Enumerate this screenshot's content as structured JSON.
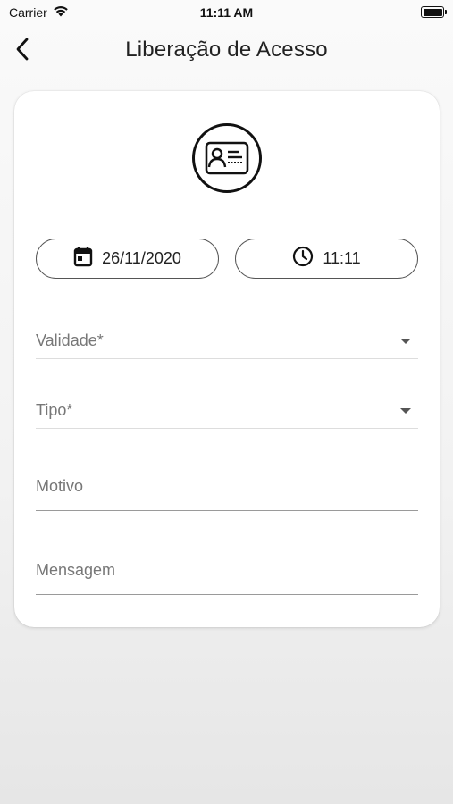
{
  "status_bar": {
    "carrier": "Carrier",
    "time": "11:11 AM",
    "wifi_icon": "wifi-icon",
    "battery_icon": "battery-icon"
  },
  "nav": {
    "back_icon": "chevron-left-icon",
    "title": "Liberação de Acesso"
  },
  "card": {
    "badge_icon": "id-card-icon",
    "date_button": {
      "icon": "calendar-icon",
      "label": "26/11/2020"
    },
    "time_button": {
      "icon": "clock-icon",
      "label": "11:11"
    },
    "fields": {
      "validade": {
        "placeholder": "Validade*",
        "type": "dropdown"
      },
      "tipo": {
        "placeholder": "Tipo*",
        "type": "dropdown"
      },
      "motivo": {
        "placeholder": "Motivo",
        "type": "text"
      },
      "mensagem": {
        "placeholder": "Mensagem",
        "type": "text"
      }
    }
  },
  "colors": {
    "background_top": "#fafafa",
    "background_bottom": "#e6e6e6",
    "card": "#ffffff",
    "text": "#222222",
    "placeholder": "#777777"
  }
}
